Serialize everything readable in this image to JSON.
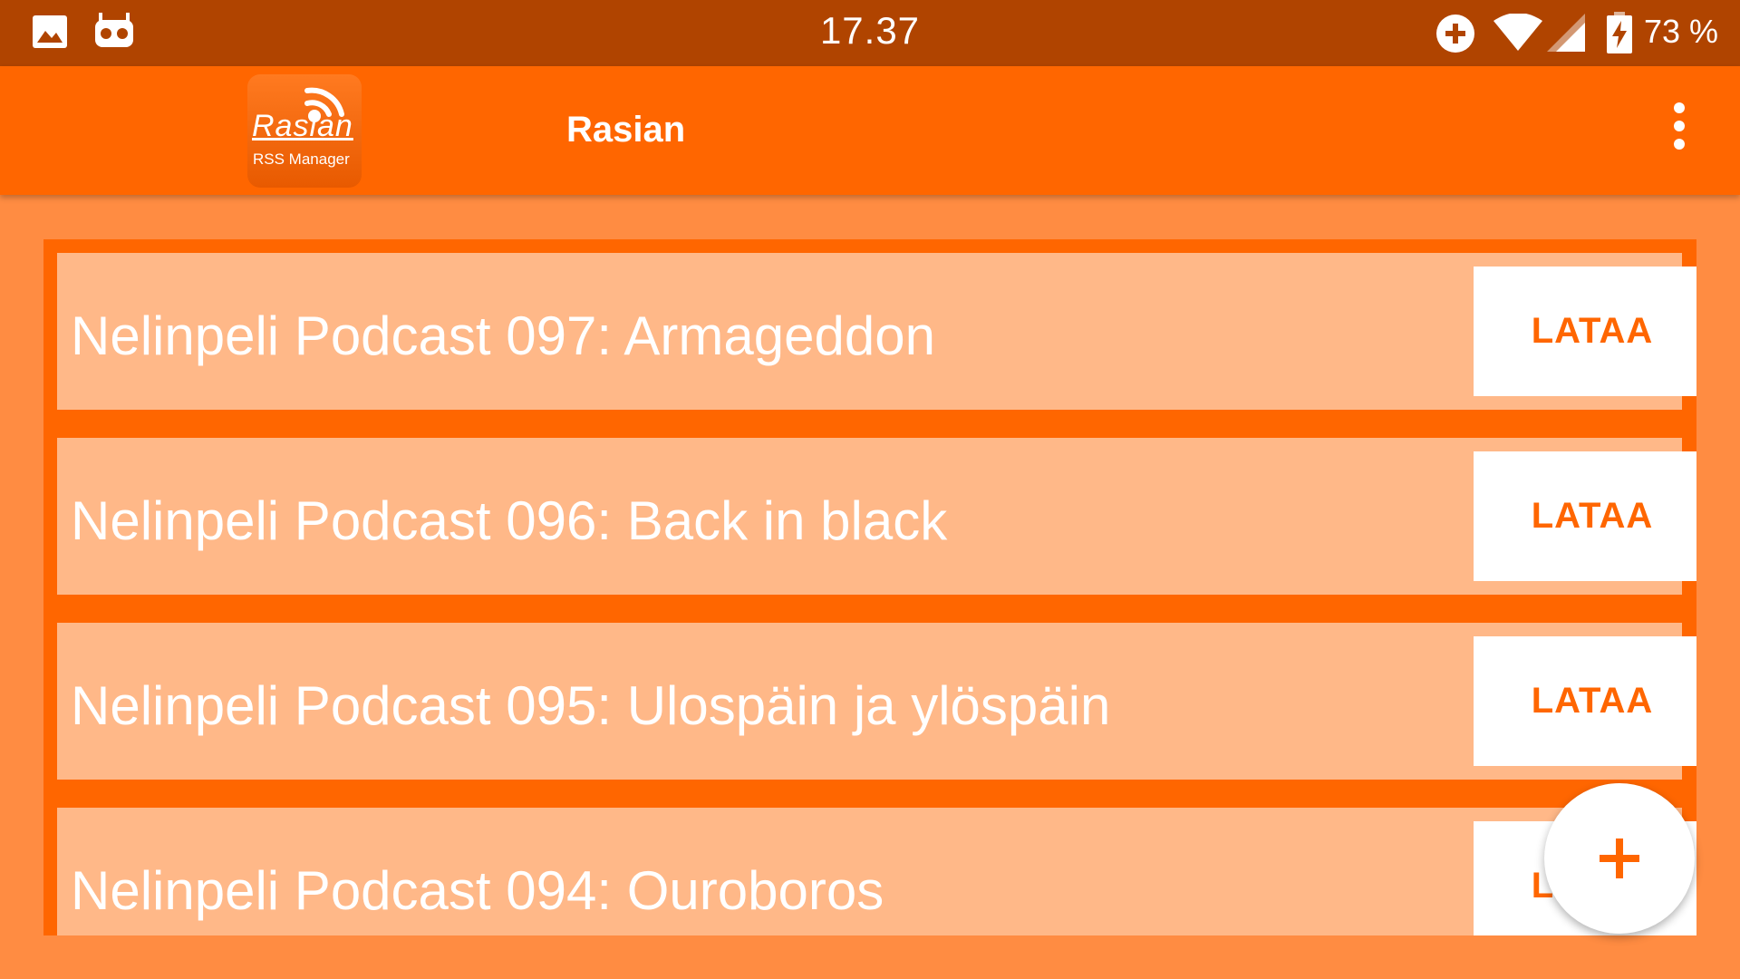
{
  "status_bar": {
    "time": "17.37",
    "battery_percent": "73 %",
    "icons": [
      "image-icon",
      "notification-app-icon",
      "add-circle-icon",
      "wifi-icon",
      "cell-signal-icon",
      "battery-charging-icon"
    ]
  },
  "app_bar": {
    "title": "Rasian",
    "logo_word": "Rasian",
    "logo_sub": "RSS Manager",
    "menu_icon": "overflow-menu-icon"
  },
  "feed": {
    "items": [
      {
        "title": "Nelinpeli Podcast 097: Armageddon",
        "action": "LATAA"
      },
      {
        "title": "Nelinpeli Podcast 096: Back in black",
        "action": "LATAA"
      },
      {
        "title": "Nelinpeli Podcast 095: Ulospäin ja ylöspäin",
        "action": "LATAA"
      },
      {
        "title": "Nelinpeli Podcast 094: Ouroboros",
        "action": "LATAA"
      }
    ]
  },
  "fab": {
    "icon": "plus-icon"
  },
  "colors": {
    "status_bar": "#b04400",
    "app_bar": "#ff6600",
    "background": "#ff8c42",
    "item_background": "#ffb888",
    "accent": "#ff6600"
  }
}
